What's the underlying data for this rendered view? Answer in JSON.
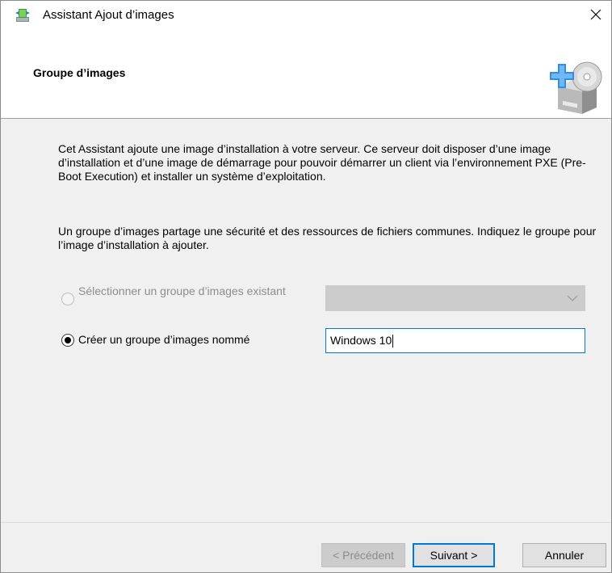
{
  "window": {
    "title": "Assistant Ajout d’images",
    "close_symbol": "✕"
  },
  "header": {
    "title": "Groupe d’images"
  },
  "content": {
    "intro": "Cet Assistant ajoute une image d’installation à votre serveur. Ce serveur doit disposer d’une image d’installation et d’une image de démarrage pour pouvoir démarrer un client via l’environnement PXE (Pre-Boot Execution) et installer un système d’exploitation.",
    "group_desc": "Un groupe d’images partage une sécurité et des ressources de fichiers communes. Indiquez le groupe pour l’image d’installation à ajouter.",
    "option_existing_label": "Sélectionner un groupe d’images existant",
    "option_new_label": "Créer un groupe d’images nommé",
    "new_group_value": "Windows 10",
    "existing_group_selected": ""
  },
  "buttons": {
    "previous": "< Précédent",
    "next": "Suivant >",
    "cancel": "Annuler"
  },
  "icons": {
    "app": "wizard-app-icon",
    "header": "add-image-server-icon",
    "close": "close-icon",
    "dropdown": "chevron-down-icon"
  },
  "colors": {
    "focus_blue": "#0078d7",
    "disabled_text": "#8d8d8d"
  }
}
